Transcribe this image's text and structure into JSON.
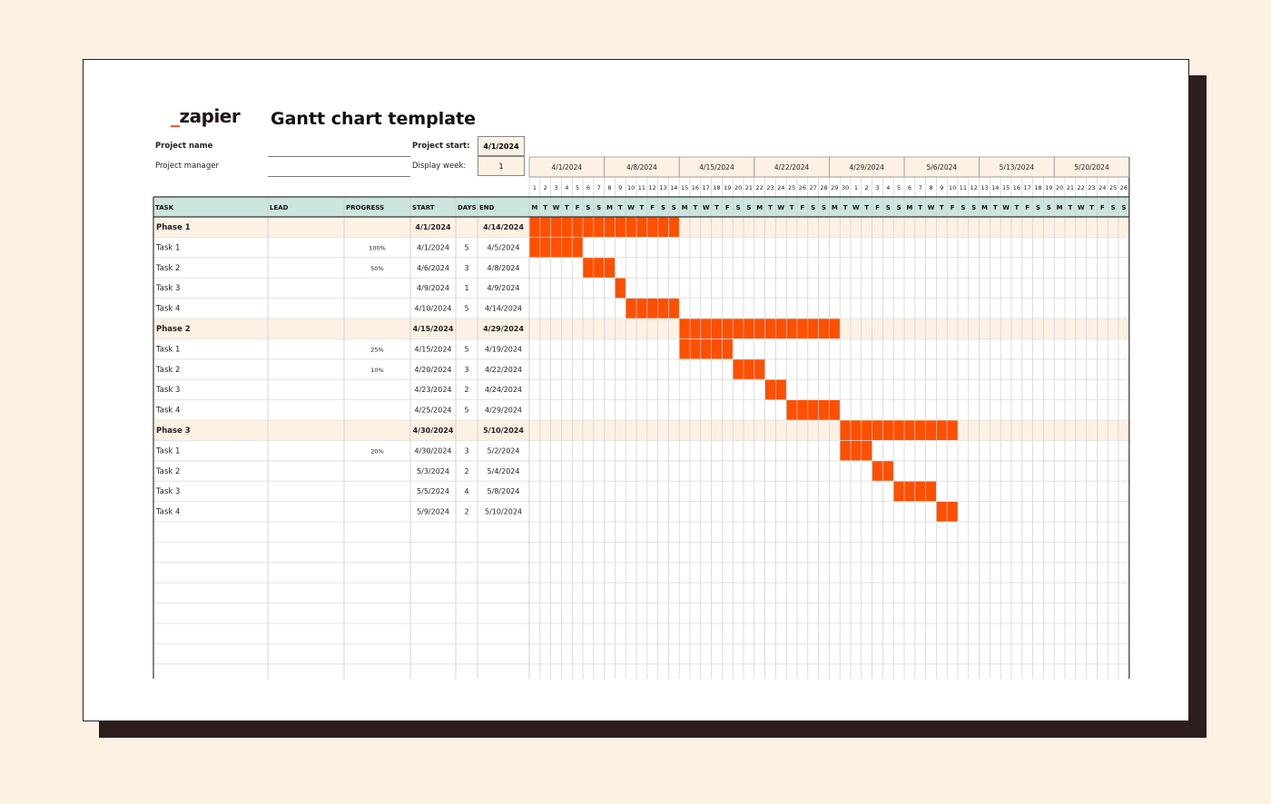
{
  "brand": {
    "logo_text": "zapier"
  },
  "title": "Gantt chart template",
  "fields": {
    "project_name_label": "Project name",
    "project_manager_label": "Project manager",
    "project_start_label": "Project start:",
    "project_start_value": "4/1/2024",
    "display_week_label": "Display week:",
    "display_week_value": "1"
  },
  "colors": {
    "accent": "#ff4f00",
    "header_bg": "#cde5df",
    "phase_bg": "#fdf1e4",
    "page_bg": "#fdf1e4",
    "shadow": "#2e1d1d"
  },
  "table": {
    "headers": [
      "TASK",
      "LEAD",
      "PROGRESS",
      "START",
      "DAYS",
      "END"
    ],
    "rows": [
      {
        "task": "Phase 1",
        "lead": "",
        "progress": "",
        "start": "4/1/2024",
        "days": "",
        "end": "4/14/2024",
        "phase": true,
        "bar_start": 1,
        "bar_days": 14
      },
      {
        "task": "Task 1",
        "lead": "",
        "progress": "100%",
        "start": "4/1/2024",
        "days": "5",
        "end": "4/5/2024",
        "phase": false,
        "bar_start": 1,
        "bar_days": 5
      },
      {
        "task": "Task 2",
        "lead": "",
        "progress": "50%",
        "start": "4/6/2024",
        "days": "3",
        "end": "4/8/2024",
        "phase": false,
        "bar_start": 6,
        "bar_days": 3
      },
      {
        "task": "Task 3",
        "lead": "",
        "progress": "",
        "start": "4/9/2024",
        "days": "1",
        "end": "4/9/2024",
        "phase": false,
        "bar_start": 9,
        "bar_days": 1
      },
      {
        "task": "Task 4",
        "lead": "",
        "progress": "",
        "start": "4/10/2024",
        "days": "5",
        "end": "4/14/2024",
        "phase": false,
        "bar_start": 10,
        "bar_days": 5
      },
      {
        "task": "Phase 2",
        "lead": "",
        "progress": "",
        "start": "4/15/2024",
        "days": "",
        "end": "4/29/2024",
        "phase": true,
        "bar_start": 15,
        "bar_days": 15
      },
      {
        "task": "Task 1",
        "lead": "",
        "progress": "25%",
        "start": "4/15/2024",
        "days": "5",
        "end": "4/19/2024",
        "phase": false,
        "bar_start": 15,
        "bar_days": 5
      },
      {
        "task": "Task 2",
        "lead": "",
        "progress": "10%",
        "start": "4/20/2024",
        "days": "3",
        "end": "4/22/2024",
        "phase": false,
        "bar_start": 20,
        "bar_days": 3
      },
      {
        "task": "Task 3",
        "lead": "",
        "progress": "",
        "start": "4/23/2024",
        "days": "2",
        "end": "4/24/2024",
        "phase": false,
        "bar_start": 23,
        "bar_days": 2
      },
      {
        "task": "Task 4",
        "lead": "",
        "progress": "",
        "start": "4/25/2024",
        "days": "5",
        "end": "4/29/2024",
        "phase": false,
        "bar_start": 25,
        "bar_days": 5
      },
      {
        "task": "Phase 3",
        "lead": "",
        "progress": "",
        "start": "4/30/2024",
        "days": "",
        "end": "5/10/2024",
        "phase": true,
        "bar_start": 30,
        "bar_days": 11
      },
      {
        "task": "Task 1",
        "lead": "",
        "progress": "20%",
        "start": "4/30/2024",
        "days": "3",
        "end": "5/2/2024",
        "phase": false,
        "bar_start": 30,
        "bar_days": 3
      },
      {
        "task": "Task 2",
        "lead": "",
        "progress": "",
        "start": "5/3/2024",
        "days": "2",
        "end": "5/4/2024",
        "phase": false,
        "bar_start": 33,
        "bar_days": 2
      },
      {
        "task": "Task 3",
        "lead": "",
        "progress": "",
        "start": "5/5/2024",
        "days": "4",
        "end": "5/8/2024",
        "phase": false,
        "bar_start": 35,
        "bar_days": 4
      },
      {
        "task": "Task 4",
        "lead": "",
        "progress": "",
        "start": "5/9/2024",
        "days": "2",
        "end": "5/10/2024",
        "phase": false,
        "bar_start": 39,
        "bar_days": 2
      }
    ]
  },
  "timeline": {
    "weeks": [
      "4/1/2024",
      "4/8/2024",
      "4/15/2024",
      "4/22/2024",
      "4/29/2024",
      "5/6/2024",
      "5/13/2024",
      "5/20/2024"
    ],
    "day_numbers": [
      "1",
      "2",
      "3",
      "4",
      "5",
      "6",
      "7",
      "8",
      "9",
      "10",
      "11",
      "12",
      "13",
      "14",
      "15",
      "16",
      "17",
      "18",
      "19",
      "20",
      "21",
      "22",
      "23",
      "24",
      "25",
      "26",
      "27",
      "28",
      "29",
      "30",
      "1",
      "2",
      "3",
      "4",
      "5",
      "6",
      "7",
      "8",
      "9",
      "10",
      "11",
      "12",
      "13",
      "14",
      "15",
      "16",
      "17",
      "18",
      "19",
      "20",
      "21",
      "22",
      "23",
      "24",
      "25",
      "26"
    ],
    "weekday_letters": [
      "M",
      "T",
      "W",
      "T",
      "F",
      "S",
      "S"
    ]
  }
}
